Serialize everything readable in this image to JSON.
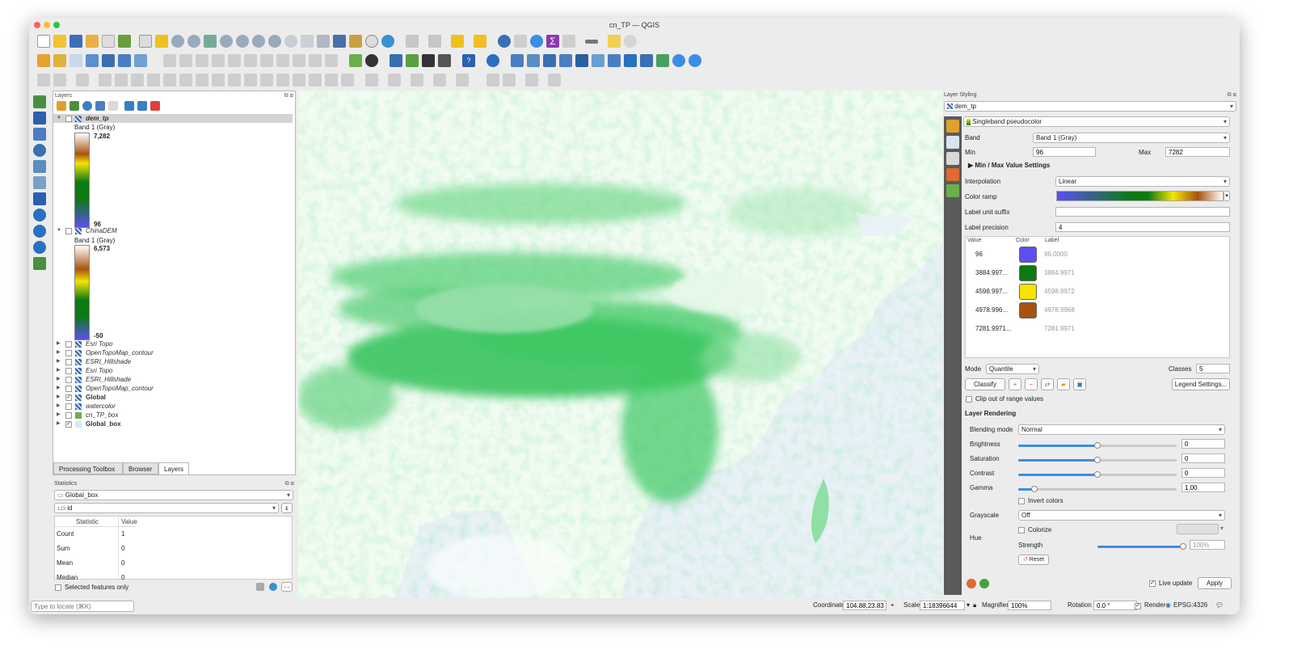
{
  "window": {
    "title": "cn_TP — QGIS"
  },
  "layers_panel": {
    "title": "Layers",
    "layers": [
      {
        "name": "dem_tp",
        "checked": false,
        "expanded": true,
        "style": "italic-bold"
      },
      {
        "name": "ChinaDEM",
        "checked": false,
        "expanded": true,
        "style": "italic"
      },
      {
        "name": "Esri Topo",
        "checked": false,
        "expanded": false,
        "style": "italic"
      },
      {
        "name": "OpenTopoMap_contour",
        "checked": false,
        "expanded": false,
        "style": "italic"
      },
      {
        "name": "ESRI_Hillshade",
        "checked": false,
        "expanded": false,
        "style": "italic"
      },
      {
        "name": "Esri Topo",
        "checked": false,
        "expanded": false,
        "style": "italic"
      },
      {
        "name": "ESRI_Hillshade",
        "checked": false,
        "expanded": false,
        "style": "italic"
      },
      {
        "name": "OpenTopoMap_contour",
        "checked": false,
        "expanded": false,
        "style": "italic"
      },
      {
        "name": "Global",
        "checked": true,
        "expanded": false,
        "style": "bold"
      },
      {
        "name": "watercolor",
        "checked": false,
        "expanded": false,
        "style": "italic"
      },
      {
        "name": "cn_TP_box",
        "checked": false,
        "expanded": false,
        "style": "italic"
      },
      {
        "name": "Global_box",
        "checked": true,
        "expanded": false,
        "style": "bold"
      }
    ],
    "dem_legend": {
      "band": "Band 1 (Gray)",
      "max": "7,282",
      "min": "96"
    },
    "china_legend": {
      "band": "Band 1 (Gray)",
      "max": "6,573",
      "min": "-50"
    }
  },
  "bottom_tabs": [
    "Processing Toolbox",
    "Browser",
    "Layers"
  ],
  "statistics": {
    "title": "Statistics",
    "layer": "Global_box",
    "field": "id",
    "field_prefix": "123",
    "headers": [
      "Statistic",
      "Value"
    ],
    "rows": [
      {
        "stat": "Count",
        "value": "1"
      },
      {
        "stat": "Sum",
        "value": "0"
      },
      {
        "stat": "Mean",
        "value": "0"
      },
      {
        "stat": "Median",
        "value": "0"
      }
    ],
    "selected_only": "Selected features only"
  },
  "styling": {
    "title": "Layer Styling",
    "layer": "dem_tp",
    "renderer": "Singleband pseudocolor",
    "band_label": "Band",
    "band": "Band 1 (Gray)",
    "min_label": "Min",
    "min": "96",
    "max_label": "Max",
    "max": "7282",
    "minmax_settings": "Min / Max Value Settings",
    "interpolation_label": "Interpolation",
    "interpolation": "Linear",
    "color_ramp_label": "Color ramp",
    "label_suffix_label": "Label unit suffix",
    "label_precision_label": "Label precision",
    "label_precision": "4",
    "table_headers": [
      "Value",
      "Color",
      "Label"
    ],
    "classes": [
      {
        "value": "96",
        "color": "#5b4ff0",
        "label": "96.0000"
      },
      {
        "value": "3884.997...",
        "color": "#0d7a13",
        "label": "3884.9971"
      },
      {
        "value": "4598.997...",
        "color": "#f5e400",
        "label": "4598.9972"
      },
      {
        "value": "4978.996...",
        "color": "#a65310",
        "label": "4978.9968"
      },
      {
        "value": "7281.9971...",
        "color": "#ffffff",
        "label": "7281.9971"
      }
    ],
    "mode_label": "Mode",
    "mode": "Quantile",
    "classes_label": "Classes",
    "classes_count": "5",
    "classify": "Classify",
    "legend_settings": "Legend Settings...",
    "clip": "Clip out of range values",
    "layer_rendering": "Layer Rendering",
    "blending_label": "Blending mode",
    "blending": "Normal",
    "brightness_label": "Brightness",
    "brightness": "0",
    "saturation_label": "Saturation",
    "saturation": "0",
    "contrast_label": "Contrast",
    "contrast": "0",
    "gamma_label": "Gamma",
    "gamma": "1.00",
    "invert_colors": "Invert colors",
    "grayscale_label": "Grayscale",
    "grayscale": "Off",
    "hue_label": "Hue",
    "colorize": "Colorize",
    "strength_label": "Strength",
    "strength": "100%",
    "reset": "Reset",
    "live_update": "Live update",
    "apply": "Apply",
    "sliders": {
      "brightness": 0.5,
      "saturation": 0.5,
      "contrast": 0.5,
      "gamma": 0.1,
      "strength": 1.0
    }
  },
  "statusbar": {
    "locate_placeholder": "Type to locate (⌘K)",
    "coordinate_label": "Coordinate",
    "coordinate": "104.88,23.83",
    "scale_label": "Scale",
    "scale": "1:18396644",
    "magnifier_label": "Magnifier",
    "magnifier": "100%",
    "rotation_label": "Rotation",
    "rotation": "0.0 °",
    "render_label": "Render",
    "crs": "EPSG:4326"
  },
  "colors": {
    "map_land": "#2fbf55",
    "map_water": "#e9f1f7",
    "accent": "#3b8ee4"
  }
}
